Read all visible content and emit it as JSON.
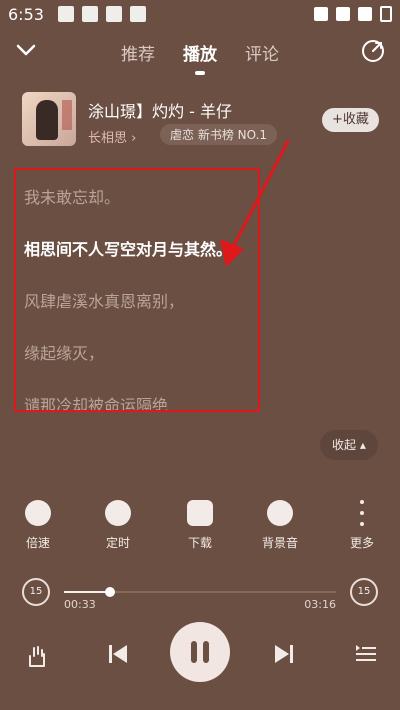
{
  "status": {
    "time": "6:53"
  },
  "topbar": {
    "tabs": [
      {
        "label": "推荐"
      },
      {
        "label": "播放"
      },
      {
        "label": "评论"
      }
    ]
  },
  "song": {
    "title": "涂山璟】灼灼 - 羊仔",
    "subtitle": "长相思",
    "chart_label": "虐恋 新书榜 NO.1",
    "collect_label": "+收藏"
  },
  "lyrics": [
    {
      "text": "我未敢忘却。"
    },
    {
      "text": "相思间不人写空对月与其然。"
    },
    {
      "text": "风肆虐溪水真恩离别，"
    },
    {
      "text": "缘起缘灭，"
    },
    {
      "text": "谴那冷却被命运隔绝"
    }
  ],
  "collapse_label": "收起 ▴",
  "actions": [
    {
      "label": "倍速"
    },
    {
      "label": "定时"
    },
    {
      "label": "下载"
    },
    {
      "label": "背景音"
    },
    {
      "label": "更多"
    }
  ],
  "progress": {
    "current": "00:33",
    "total": "03:16",
    "fraction": 0.17,
    "skip_back": "15",
    "skip_forward": "15"
  },
  "colors": {
    "background": "#6b4f43",
    "highlight_box": "#e0171b"
  }
}
